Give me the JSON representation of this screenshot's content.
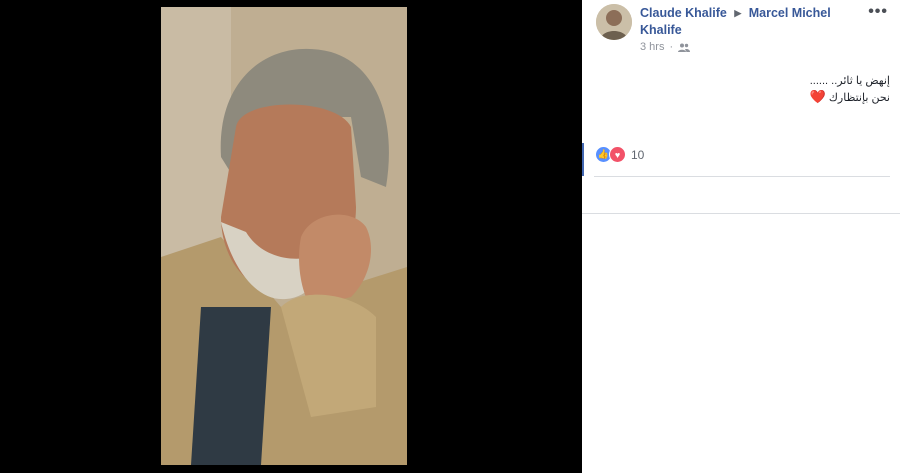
{
  "post": {
    "author": "Claude Khalife",
    "target": "Marcel Michel Khalife",
    "time": "3 hrs",
    "text_line1": "إنهض يا ثائر.. ......",
    "text_line2": "نحن بإنتظارك",
    "heart": "❤️",
    "reaction_count": "10"
  },
  "icons": {
    "privacy": "friends-icon",
    "more": "more-options-icon",
    "arrow": "arrow-right-icon"
  },
  "colors": {
    "link": "#385898",
    "like": "#5890ff",
    "love": "#f25268"
  }
}
